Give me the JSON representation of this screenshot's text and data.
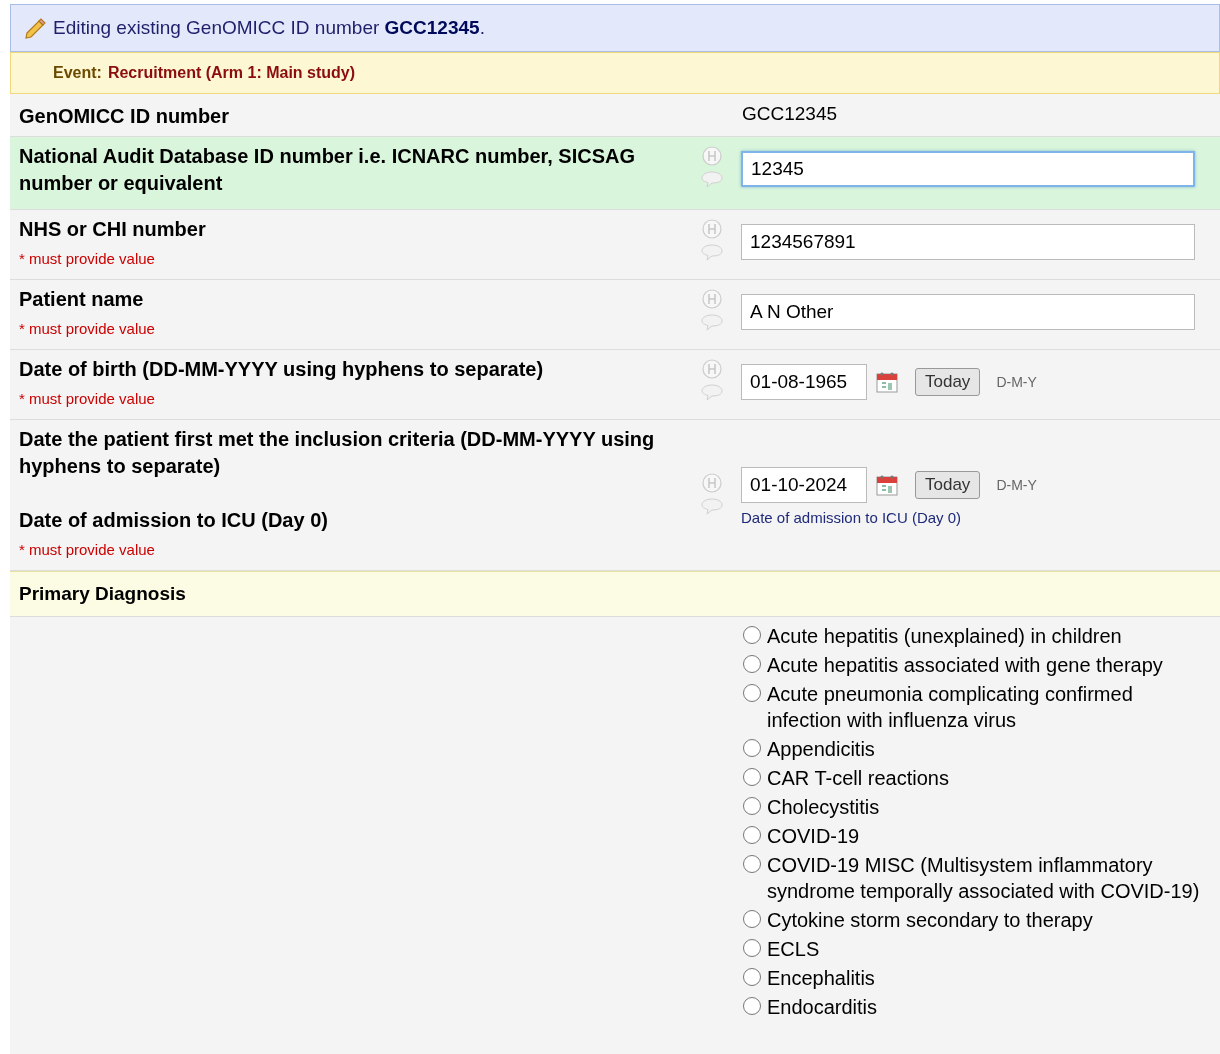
{
  "banner": {
    "text": "Editing existing GenOMICC ID number **GCC12345**."
  },
  "event": {
    "label": "Event:",
    "value": "Recruitment (Arm 1: Main study)"
  },
  "fields": [
    {
      "kind": "readonly",
      "label": "GenOMICC ID number",
      "value": "GCC12345",
      "highlighted": false
    },
    {
      "kind": "text",
      "label": "National Audit Database ID number i.e. ICNARC number, SICSAG number or equivalent",
      "value": "12345",
      "highlighted": true,
      "focused": true
    },
    {
      "kind": "text",
      "label": "NHS or CHI number",
      "required_note": "* must provide value",
      "value": "1234567891",
      "highlighted": false,
      "focused": false
    },
    {
      "kind": "text",
      "label": "Patient name",
      "required_note": "* must provide value",
      "value": "A N Other",
      "highlighted": false,
      "focused": false
    },
    {
      "kind": "date",
      "label": "Date of birth (DD-MM-YYYY using hyphens to separate)",
      "required_note": "* must provide value",
      "value": "01-08-1965",
      "today_button": "Today",
      "format": "D-M-Y",
      "highlighted": false,
      "focused": false
    },
    {
      "kind": "date",
      "label": "Date the patient first met the inclusion criteria (DD-MM-YYYY using hyphens to separate)",
      "sublabel": "Date of admission to ICU (Day 0)",
      "required_note": "* must provide value",
      "value": "01-10-2024",
      "today_button": "Today",
      "format": "D-M-Y",
      "note": "Date of admission to ICU (Day 0)",
      "highlighted": false,
      "focused": false
    }
  ],
  "section": {
    "title": "Primary Diagnosis"
  },
  "options": [
    {
      "label": "Acute hepatitis (unexplained) in children",
      "selected": false
    },
    {
      "label": "Acute hepatitis associated with gene therapy",
      "selected": false
    },
    {
      "label": "Acute pneumonia complicating confirmed infection with influenza virus",
      "selected": false
    },
    {
      "label": "Appendicitis",
      "selected": false
    },
    {
      "label": "CAR T-cell reactions",
      "selected": false
    },
    {
      "label": "Cholecystitis",
      "selected": false
    },
    {
      "label": "COVID-19",
      "selected": false
    },
    {
      "label": "COVID-19 MISC (Multisystem inflammatory syndrome temporally associated with COVID-19)",
      "selected": false
    },
    {
      "label": "Cytokine storm secondary to therapy",
      "selected": false
    },
    {
      "label": "ECLS",
      "selected": false
    },
    {
      "label": "Encephalitis",
      "selected": false
    },
    {
      "label": "Endocarditis",
      "selected": false
    }
  ]
}
